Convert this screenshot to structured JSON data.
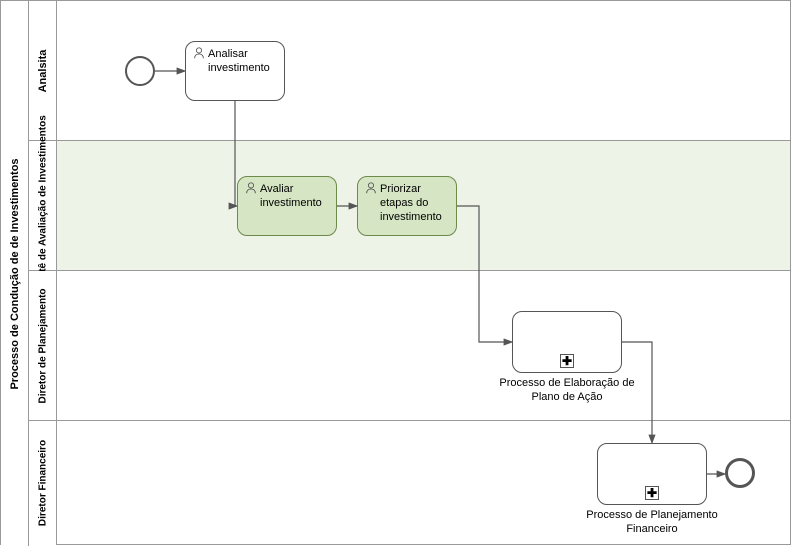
{
  "pool_label": "Processo de Condução de de Investimentos",
  "lanes": {
    "analista": "Analsita",
    "comite": "Comitê de Avaliação de Investimentos",
    "diretor_planejamento": "Diretor de Planejamento",
    "diretor_financeiro": "Diretor Financeiro"
  },
  "tasks": {
    "analisar": "Analisar investimento",
    "avaliar": "Avaliar investimento",
    "priorizar": "Priorizar etapas do investimento"
  },
  "subprocesses": {
    "plano_acao": "Processo de Elaboração de Plano de Ação",
    "planejamento_financeiro": "Processo de Planejamento Financeiro"
  },
  "chart_data": {
    "type": "bpmn-flow",
    "pool": "Processo de Condução de de Investimentos",
    "lanes": [
      "Analsita",
      "Comitê de Avaliação de Investimentos",
      "Diretor de Planejamento",
      "Diretor Financeiro"
    ],
    "elements": [
      {
        "id": "start",
        "type": "startEvent",
        "lane": "Analsita"
      },
      {
        "id": "t1",
        "type": "userTask",
        "lane": "Analsita",
        "name": "Analisar investimento"
      },
      {
        "id": "t2",
        "type": "userTask",
        "lane": "Comitê de Avaliação de Investimentos",
        "name": "Avaliar investimento",
        "highlight": true
      },
      {
        "id": "t3",
        "type": "userTask",
        "lane": "Comitê de Avaliação de Investimentos",
        "name": "Priorizar etapas do investimento",
        "highlight": true
      },
      {
        "id": "sp1",
        "type": "subProcess",
        "lane": "Diretor de Planejamento",
        "name": "Processo de Elaboração de Plano de Ação"
      },
      {
        "id": "sp2",
        "type": "subProcess",
        "lane": "Diretor Financeiro",
        "name": "Processo de Planejamento Financeiro"
      },
      {
        "id": "end",
        "type": "endEvent",
        "lane": "Diretor Financeiro"
      }
    ],
    "flows": [
      [
        "start",
        "t1"
      ],
      [
        "t1",
        "t2"
      ],
      [
        "t2",
        "t3"
      ],
      [
        "t3",
        "sp1"
      ],
      [
        "sp1",
        "sp2"
      ],
      [
        "sp2",
        "end"
      ]
    ]
  }
}
